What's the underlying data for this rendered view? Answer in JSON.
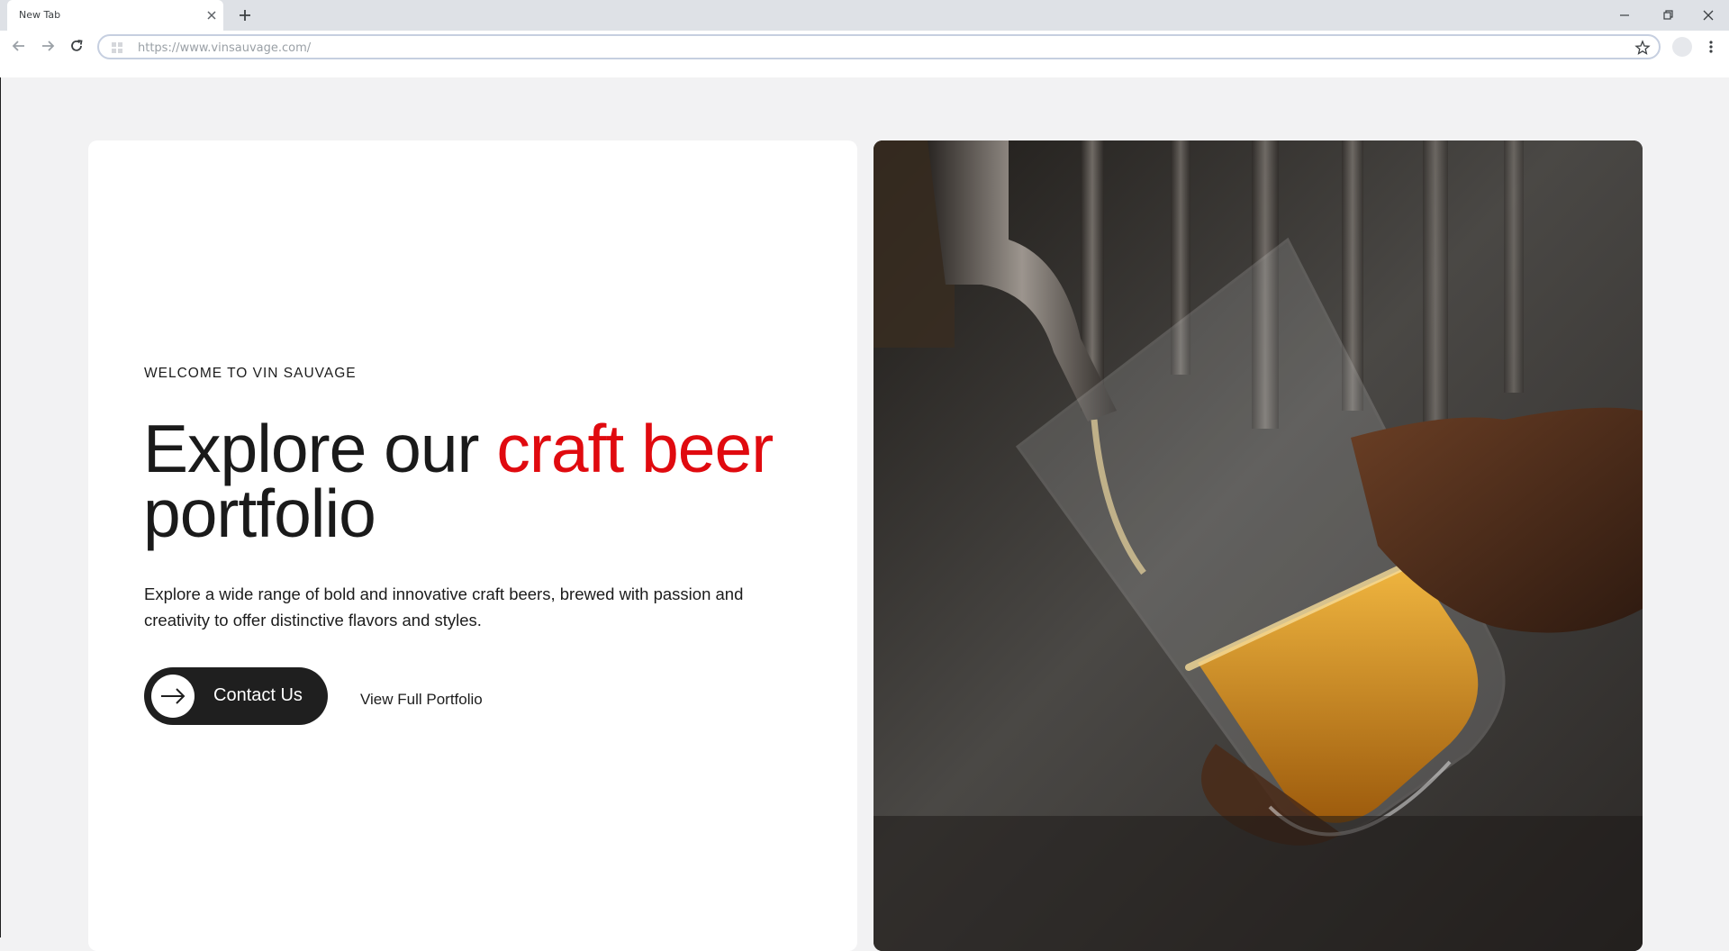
{
  "browser": {
    "tab_title": "New Tab",
    "url": "https://www.vinsauvage.com/",
    "icons": {
      "tab_close": "close-icon",
      "new_tab": "plus-icon",
      "back": "arrow-left-icon",
      "forward": "arrow-right-icon",
      "reload": "reload-icon",
      "site": "site-info-icon",
      "bookmark": "star-icon",
      "profile": "profile-avatar",
      "menu": "kebab-menu-icon",
      "minimize": "minimize-icon",
      "restore": "restore-icon",
      "close_window": "close-icon"
    }
  },
  "hero": {
    "eyebrow": "WELCOME TO VIN SAUVAGE",
    "headline_pre": "Explore our ",
    "headline_accent": "craft beer",
    "headline_post": "portfolio",
    "lead": "Explore a wide range of bold and innovative craft beers, brewed with passion and creativity to offer distinctive flavors and styles.",
    "primary_button": "Contact Us",
    "secondary_link": "View Full Portfolio",
    "image": "beer-pour-photo"
  },
  "colors": {
    "accent": "#e00a0f",
    "text": "#1a1a1a",
    "button_bg": "#1f1f1f",
    "page_bg": "#f2f2f3",
    "card_bg": "#ffffff"
  }
}
